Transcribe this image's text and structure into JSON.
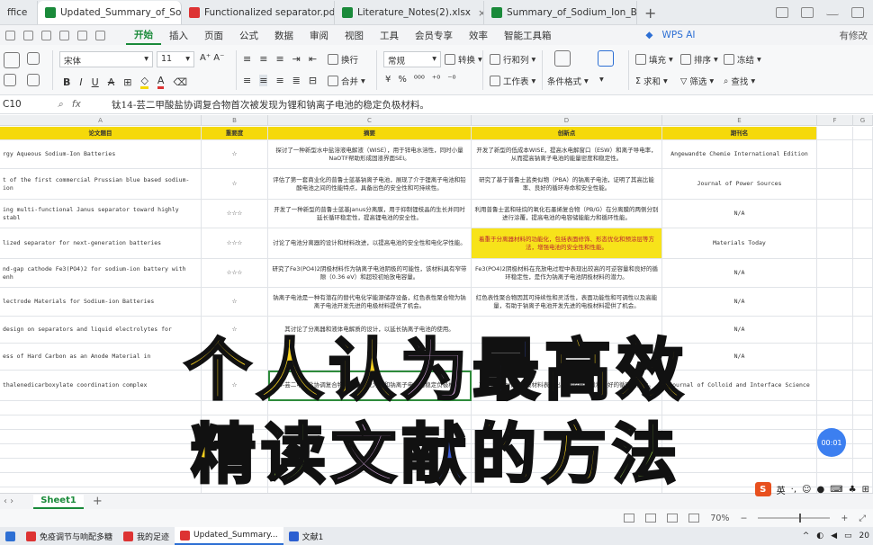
{
  "tabs": [
    {
      "label": "ffice",
      "color": "#d33"
    },
    {
      "label": "Updated_Summary_of_Sodium",
      "color": "#1a8a3a",
      "active": true
    },
    {
      "label": "Functionalized separator.pdf",
      "color": "#d33"
    },
    {
      "label": "Literature_Notes(2).xlsx",
      "color": "#1a8a3a"
    },
    {
      "label": "Summary_of_Sodium_Ion_Battery",
      "color": "#1a8a3a"
    }
  ],
  "menu": {
    "items": [
      "开始",
      "插入",
      "页面",
      "公式",
      "数据",
      "审阅",
      "视图",
      "工具",
      "会员专享",
      "效率",
      "智能工具箱"
    ],
    "active": "开始",
    "wps_ai": "WPS AI",
    "right_label": "有修改"
  },
  "ribbon": {
    "font": "宋体",
    "size": "11",
    "wrap": "换行",
    "merge": "合并",
    "format": "常规",
    "convert": "转换",
    "rowcol": "行和列",
    "sheet": "工作表",
    "condfmt": "条件格式",
    "fill": "填充",
    "sort": "排序",
    "freeze": "冻结",
    "sum": "求和",
    "filter": "筛选",
    "find": "查找"
  },
  "formula_bar": {
    "cell": "C10",
    "text": "钛14-芸二甲酸盐协调复合物首次被发现为锂和钠离子电池的稳定负极材料。"
  },
  "columns": [
    "A",
    "B",
    "C",
    "D",
    "E",
    "F",
    "G"
  ],
  "header_row": [
    "论文题目",
    "重要度",
    "摘要",
    "创新点",
    "期刊名"
  ],
  "rows": [
    {
      "title": "rgy Aqueous Sodium-Ion Batteries",
      "stars": "☆",
      "summary": "探讨了一种新型水中盐溶液电解液（WISE），用于锌电水溶性，同时小量NaOTF帮助形成固液界面SEI。",
      "innovation": "开发了新型的低成本WISE，提高水电解窗口（ESW）和离子导电率，从而提高钠离子电池的能量密度和稳定性。",
      "journal": "Angewandte Chemie International Edition"
    },
    {
      "title": "t of the first commercial Prussian blue based sodium-ion",
      "stars": "☆",
      "summary": "评估了第一套商业化的普鲁士蓝基钠离子电池，展现了介于锂离子电池和铅酸电池之间的性能特点，具备出色的安全性和可持续性。",
      "innovation": "研究了基于普鲁士蓝类似物（PBA）的钠离子电池，证明了其高比能率、良好的循环寿命和安全性能。",
      "journal": "Journal of Power Sources"
    },
    {
      "title": "ing multi-functional Janus separator toward highly stabl",
      "stars": "☆☆☆",
      "summary": "开发了一种新型的普鲁士蓝基Janus分离膜，用于抑制锂枝晶的生长并同时延长循环稳定性，提高锂电池的安全性。",
      "innovation": "利用普鲁士蓝和硅烷的氧化石墨烯复合物（PB/G）在分离膜的两侧分别进行涂覆，提高电池的电容储能能力和循环性能。",
      "journal": "N/A"
    },
    {
      "title": "lized separator for next-generation batteries",
      "stars": "☆☆☆",
      "summary": "讨论了电池分离器的设计和材料改进，以提高电池的安全性和电化学性能。",
      "innovation": "着重于分离器材料的功能化，包括表面修饰、形态优化和预涂层等方法，增强电池的安全性和性能。",
      "journal": "Materials Today",
      "highlight": true
    },
    {
      "title": "nd-gap cathode Fe3(PO4)2 for sodium-ion battery with enh",
      "stars": "☆☆☆",
      "summary": "研究了Fe3(PO4)2阴极材料作为钠离子电池阴极的可能性，该材料具有窄带隙（0.36 eV）和超较初始放电容量。",
      "innovation": "Fe3(PO4)2阴极材料在充放电过程中表现出较高的可逆容量和良好的循环稳定性，是作为钠离子电池阴极材料的潜力。",
      "journal": "N/A"
    },
    {
      "title": "lectrode Materials for Sodium-ion Batteries",
      "stars": "☆",
      "summary": "钠离子电池是一种有潜在的替代电化学能源储存设备，红色表性聚合物为钠离子电池开发先进的电极材料提供了机会。",
      "innovation": "红色表性聚合物因其可持续性和灵活性，表面功能性和可调性以及高能量，有助于钠离子电池开发先进的电极材料提供了机会。",
      "journal": "N/A"
    },
    {
      "title": "design on separators and liquid electrolytes for",
      "stars": "☆",
      "summary": "其讨论了分离器和液体电解质的设计，以延长钠离子电池的使用。",
      "innovation": "",
      "journal": "N/A"
    },
    {
      "title": "ess of Hard Carbon as an Anode Material in",
      "stars": "☆",
      "summary": "",
      "innovation": "",
      "journal": "N/A"
    },
    {
      "title": "thalenedicarboxylate coordination complex",
      "stars": "☆",
      "summary": "4-芸二甲酸盐协调复合物首次被发现为锂和钠离子电池的稳定负极材料",
      "innovation": "离子电池中作为负极材料表现出良好的电容量和良好的循环稳定性。",
      "journal": "Journal of Colloid and Interface Science",
      "selected": true
    }
  ],
  "overlay": {
    "line1": [
      {
        "text": "个",
        "color": "yellow"
      },
      {
        "text": "人",
        "color": "yellow"
      },
      {
        "text": "认",
        "color": "yellow"
      },
      {
        "text": "为",
        "color": "purple"
      },
      {
        "text": "最",
        "color": "blue"
      },
      {
        "text": "高",
        "color": "yellow"
      },
      {
        "text": "效",
        "color": "yellow"
      }
    ],
    "line2": [
      {
        "text": "精",
        "color": "yellow"
      },
      {
        "text": "读",
        "color": "green"
      },
      {
        "text": "文",
        "color": "purple"
      },
      {
        "text": "献",
        "color": "blue"
      },
      {
        "text": "的",
        "color": "yellow"
      },
      {
        "text": "方",
        "color": "yellow"
      },
      {
        "text": "法",
        "color": "green"
      }
    ]
  },
  "timer": "00:01",
  "sheet_tab": "Sheet1",
  "ime_label": "英",
  "status": {
    "zoom": "70%"
  },
  "taskbar": [
    {
      "label": "免疫调节与响配多糖",
      "color": "#d33"
    },
    {
      "label": "我的足迹",
      "color": "#d33"
    },
    {
      "label": "Updated_Summary...",
      "color": "#d33",
      "active": true
    },
    {
      "label": "文献1",
      "color": "#2b5fd1"
    }
  ],
  "clock": "20"
}
